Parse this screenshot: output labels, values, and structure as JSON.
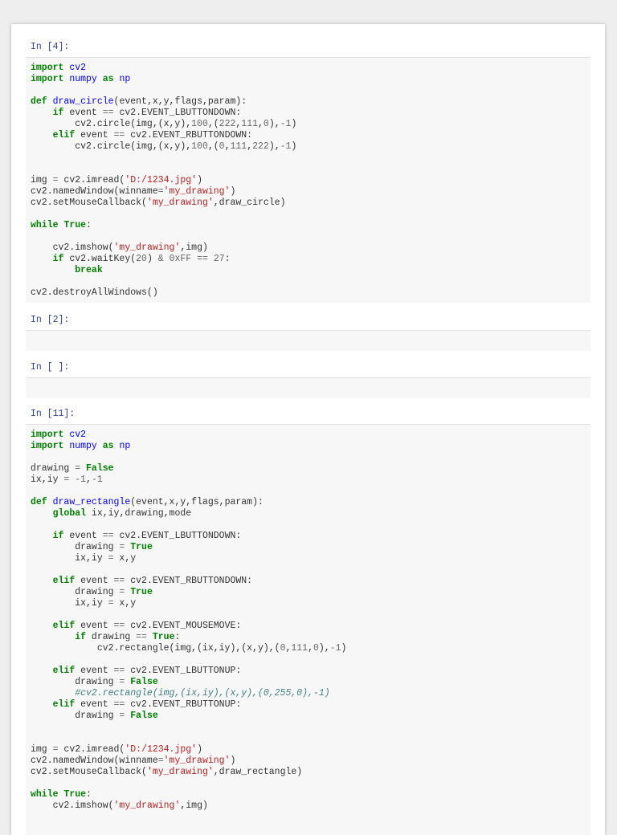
{
  "cells": [
    {
      "prompt": "In [4]:",
      "lines": [
        [
          [
            "kn",
            "import"
          ],
          [
            "t",
            " "
          ],
          [
            "nm",
            "cv2"
          ]
        ],
        [
          [
            "kn",
            "import"
          ],
          [
            "t",
            " "
          ],
          [
            "nm",
            "numpy"
          ],
          [
            "t",
            " "
          ],
          [
            "kn",
            "as"
          ],
          [
            "t",
            " "
          ],
          [
            "nm",
            "np"
          ]
        ],
        [],
        [
          [
            "kw",
            "def"
          ],
          [
            "t",
            " "
          ],
          [
            "fn",
            "draw_circle"
          ],
          [
            "t",
            "(event,x,y,flags,param):"
          ]
        ],
        [
          [
            "t",
            "    "
          ],
          [
            "kw",
            "if"
          ],
          [
            "t",
            " event "
          ],
          [
            "op",
            "=="
          ],
          [
            "t",
            " cv2.EVENT_LBUTTONDOWN:"
          ]
        ],
        [
          [
            "t",
            "        cv2.circle(img,(x,y),"
          ],
          [
            "num",
            "100"
          ],
          [
            "t",
            ",("
          ],
          [
            "num",
            "222"
          ],
          [
            "t",
            ","
          ],
          [
            "num",
            "111"
          ],
          [
            "t",
            ","
          ],
          [
            "num",
            "0"
          ],
          [
            "t",
            "),"
          ],
          [
            "op",
            "-"
          ],
          [
            "num",
            "1"
          ],
          [
            "t",
            ")"
          ]
        ],
        [
          [
            "t",
            "    "
          ],
          [
            "kw",
            "elif"
          ],
          [
            "t",
            " event "
          ],
          [
            "op",
            "=="
          ],
          [
            "t",
            " cv2.EVENT_RBUTTONDOWN:"
          ]
        ],
        [
          [
            "t",
            "        cv2.circle(img,(x,y),"
          ],
          [
            "num",
            "100"
          ],
          [
            "t",
            ",("
          ],
          [
            "num",
            "0"
          ],
          [
            "t",
            ","
          ],
          [
            "num",
            "111"
          ],
          [
            "t",
            ","
          ],
          [
            "num",
            "222"
          ],
          [
            "t",
            "),"
          ],
          [
            "op",
            "-"
          ],
          [
            "num",
            "1"
          ],
          [
            "t",
            ")"
          ]
        ],
        [],
        [],
        [
          [
            "t",
            "img "
          ],
          [
            "op",
            "="
          ],
          [
            "t",
            " cv2.imread("
          ],
          [
            "str",
            "'D:/1234.jpg'"
          ],
          [
            "t",
            ")"
          ]
        ],
        [
          [
            "t",
            "cv2.namedWindow(winname"
          ],
          [
            "op",
            "="
          ],
          [
            "str",
            "'my_drawing'"
          ],
          [
            "t",
            ")"
          ]
        ],
        [
          [
            "t",
            "cv2.setMouseCallback("
          ],
          [
            "str",
            "'my_drawing'"
          ],
          [
            "t",
            ",draw_circle)"
          ]
        ],
        [],
        [
          [
            "kw",
            "while"
          ],
          [
            "t",
            " "
          ],
          [
            "kw",
            "True"
          ],
          [
            "t",
            ":"
          ]
        ],
        [],
        [
          [
            "t",
            "    cv2.imshow("
          ],
          [
            "str",
            "'my_drawing'"
          ],
          [
            "t",
            ",img)"
          ]
        ],
        [
          [
            "t",
            "    "
          ],
          [
            "kw",
            "if"
          ],
          [
            "t",
            " cv2.waitKey("
          ],
          [
            "num",
            "20"
          ],
          [
            "t",
            ") "
          ],
          [
            "op",
            "&"
          ],
          [
            "t",
            " "
          ],
          [
            "num",
            "0xFF"
          ],
          [
            "t",
            " "
          ],
          [
            "op",
            "=="
          ],
          [
            "t",
            " "
          ],
          [
            "num",
            "27"
          ],
          [
            "t",
            ":"
          ]
        ],
        [
          [
            "t",
            "        "
          ],
          [
            "kw",
            "break"
          ]
        ],
        [],
        [
          [
            "t",
            "cv2.destroyAllWindows()"
          ]
        ]
      ]
    },
    {
      "prompt": "In [2]:",
      "lines": []
    },
    {
      "prompt": "In [ ]:",
      "lines": []
    },
    {
      "prompt": "In [11]:",
      "lines": [
        [
          [
            "kn",
            "import"
          ],
          [
            "t",
            " "
          ],
          [
            "nm",
            "cv2"
          ]
        ],
        [
          [
            "kn",
            "import"
          ],
          [
            "t",
            " "
          ],
          [
            "nm",
            "numpy"
          ],
          [
            "t",
            " "
          ],
          [
            "kn",
            "as"
          ],
          [
            "t",
            " "
          ],
          [
            "nm",
            "np"
          ]
        ],
        [],
        [
          [
            "t",
            "drawing "
          ],
          [
            "op",
            "="
          ],
          [
            "t",
            " "
          ],
          [
            "kw",
            "False"
          ]
        ],
        [
          [
            "t",
            "ix,iy "
          ],
          [
            "op",
            "="
          ],
          [
            "t",
            " "
          ],
          [
            "op",
            "-"
          ],
          [
            "num",
            "1"
          ],
          [
            "t",
            ","
          ],
          [
            "op",
            "-"
          ],
          [
            "num",
            "1"
          ]
        ],
        [],
        [
          [
            "kw",
            "def"
          ],
          [
            "t",
            " "
          ],
          [
            "fn",
            "draw_rectangle"
          ],
          [
            "t",
            "(event,x,y,flags,param):"
          ]
        ],
        [
          [
            "t",
            "    "
          ],
          [
            "kw",
            "global"
          ],
          [
            "t",
            " ix,iy,drawing,mode"
          ]
        ],
        [],
        [
          [
            "t",
            "    "
          ],
          [
            "kw",
            "if"
          ],
          [
            "t",
            " event "
          ],
          [
            "op",
            "=="
          ],
          [
            "t",
            " cv2.EVENT_LBUTTONDOWN:"
          ]
        ],
        [
          [
            "t",
            "        drawing "
          ],
          [
            "op",
            "="
          ],
          [
            "t",
            " "
          ],
          [
            "kw",
            "True"
          ]
        ],
        [
          [
            "t",
            "        ix,iy "
          ],
          [
            "op",
            "="
          ],
          [
            "t",
            " x,y"
          ]
        ],
        [],
        [
          [
            "t",
            "    "
          ],
          [
            "kw",
            "elif"
          ],
          [
            "t",
            " event "
          ],
          [
            "op",
            "=="
          ],
          [
            "t",
            " cv2.EVENT_RBUTTONDOWN:"
          ]
        ],
        [
          [
            "t",
            "        drawing "
          ],
          [
            "op",
            "="
          ],
          [
            "t",
            " "
          ],
          [
            "kw",
            "True"
          ]
        ],
        [
          [
            "t",
            "        ix,iy "
          ],
          [
            "op",
            "="
          ],
          [
            "t",
            " x,y"
          ]
        ],
        [],
        [
          [
            "t",
            "    "
          ],
          [
            "kw",
            "elif"
          ],
          [
            "t",
            " event "
          ],
          [
            "op",
            "=="
          ],
          [
            "t",
            " cv2.EVENT_MOUSEMOVE:"
          ]
        ],
        [
          [
            "t",
            "        "
          ],
          [
            "kw",
            "if"
          ],
          [
            "t",
            " drawing "
          ],
          [
            "op",
            "=="
          ],
          [
            "t",
            " "
          ],
          [
            "kw",
            "True"
          ],
          [
            "t",
            ":"
          ]
        ],
        [
          [
            "t",
            "            cv2.rectangle(img,(ix,iy),(x,y),("
          ],
          [
            "num",
            "0"
          ],
          [
            "t",
            ","
          ],
          [
            "num",
            "111"
          ],
          [
            "t",
            ","
          ],
          [
            "num",
            "0"
          ],
          [
            "t",
            "),"
          ],
          [
            "op",
            "-"
          ],
          [
            "num",
            "1"
          ],
          [
            "t",
            ")"
          ]
        ],
        [],
        [
          [
            "t",
            "    "
          ],
          [
            "kw",
            "elif"
          ],
          [
            "t",
            " event "
          ],
          [
            "op",
            "=="
          ],
          [
            "t",
            " cv2.EVENT_LBUTTONUP:"
          ]
        ],
        [
          [
            "t",
            "        drawing "
          ],
          [
            "op",
            "="
          ],
          [
            "t",
            " "
          ],
          [
            "kw",
            "False"
          ]
        ],
        [
          [
            "t",
            "        "
          ],
          [
            "cm",
            "#cv2.rectangle(img,(ix,iy),(x,y),(0,255,0),-1)"
          ]
        ],
        [
          [
            "t",
            "    "
          ],
          [
            "kw",
            "elif"
          ],
          [
            "t",
            " event "
          ],
          [
            "op",
            "=="
          ],
          [
            "t",
            " cv2.EVENT_RBUTTONUP:"
          ]
        ],
        [
          [
            "t",
            "        drawing "
          ],
          [
            "op",
            "="
          ],
          [
            "t",
            " "
          ],
          [
            "kw",
            "False"
          ]
        ],
        [],
        [],
        [
          [
            "t",
            "img "
          ],
          [
            "op",
            "="
          ],
          [
            "t",
            " cv2.imread("
          ],
          [
            "str",
            "'D:/1234.jpg'"
          ],
          [
            "t",
            ")"
          ]
        ],
        [
          [
            "t",
            "cv2.namedWindow(winname"
          ],
          [
            "op",
            "="
          ],
          [
            "str",
            "'my_drawing'"
          ],
          [
            "t",
            ")"
          ]
        ],
        [
          [
            "t",
            "cv2.setMouseCallback("
          ],
          [
            "str",
            "'my_drawing'"
          ],
          [
            "t",
            ",draw_rectangle)"
          ]
        ],
        [],
        [
          [
            "kw",
            "while"
          ],
          [
            "t",
            " "
          ],
          [
            "kw",
            "True"
          ],
          [
            "t",
            ":"
          ]
        ],
        [
          [
            "t",
            "    cv2.imshow("
          ],
          [
            "str",
            "'my_drawing'"
          ],
          [
            "t",
            ",img)"
          ]
        ]
      ]
    }
  ]
}
